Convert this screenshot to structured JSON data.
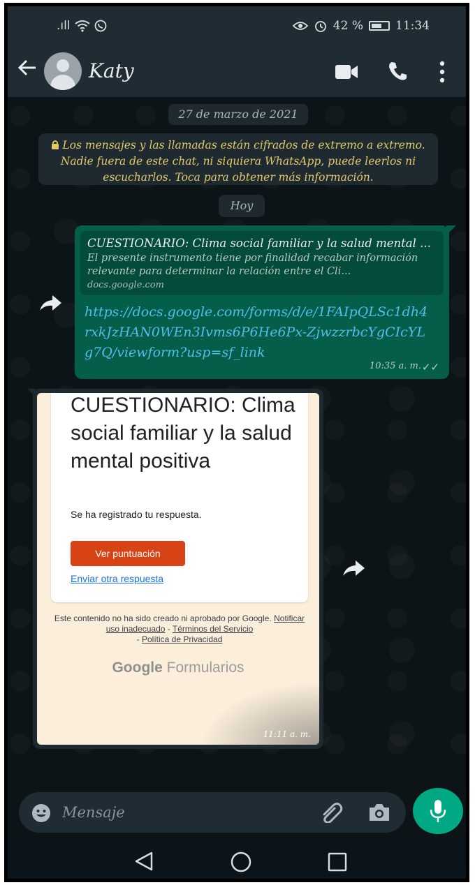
{
  "status_bar": {
    "signal": ".ıll",
    "wifi": "wifi-icon",
    "whatsapp_notif": "whatsapp-icon",
    "eye": "eye-icon",
    "alarm": "alarm-icon",
    "battery_percent": "42 %",
    "time": "11:34"
  },
  "header": {
    "contact_name": "Katy"
  },
  "chat": {
    "date_label": "27 de marzo de 2021",
    "encryption_notice": "Los mensajes y las llamadas están cifrados de extremo a extremo. Nadie fuera de este chat, ni siquiera WhatsApp, puede leerlos ni escucharlos. Toca para obtener más información.",
    "today_label": "Hoy",
    "outgoing": {
      "preview_title": "CUESTIONARIO: Clima social familiar y la salud mental ...",
      "preview_description": "El presente instrumento tiene por finalidad recabar información relevante para determinar la relación entre el Cli...",
      "preview_domain": "docs.google.com",
      "link": "https://docs.google.com/forms/d/e/1FAIpQLSc1dh4rxkJzHAN0WEn3Ivms6P6He6Px-ZjwzzrbcYgCIcYLg7Q/viewform?usp=sf_link",
      "time": "10:35 a. m.",
      "ticks": "✓✓"
    },
    "image": {
      "form_title": "CUESTIONARIO: Clima social familiar y la salud mental positiva",
      "confirmation": "Se ha registrado tu respuesta.",
      "score_button": "Ver puntuación",
      "another_response": "Enviar otra respuesta",
      "disclaimer_prefix": "Este contenido no ha sido creado ni aprobado por Google.",
      "disclaimer_report": "Notificar uso inadecuado",
      "disclaimer_sep1": " - ",
      "disclaimer_terms": "Términos del Servicio",
      "disclaimer_sep2": " - ",
      "disclaimer_privacy": "Política de Privacidad",
      "logo_google": "Google",
      "logo_forms": "Formularios",
      "time": "11:11 a. m."
    }
  },
  "input": {
    "placeholder": "Mensaje"
  },
  "colors": {
    "header_bg": "#1f2c33",
    "outgoing_bubble": "#055e4a",
    "link": "#53bdeb",
    "mic_button": "#00a884",
    "score_button": "#d84315",
    "encryption_text": "#e4c96a"
  }
}
